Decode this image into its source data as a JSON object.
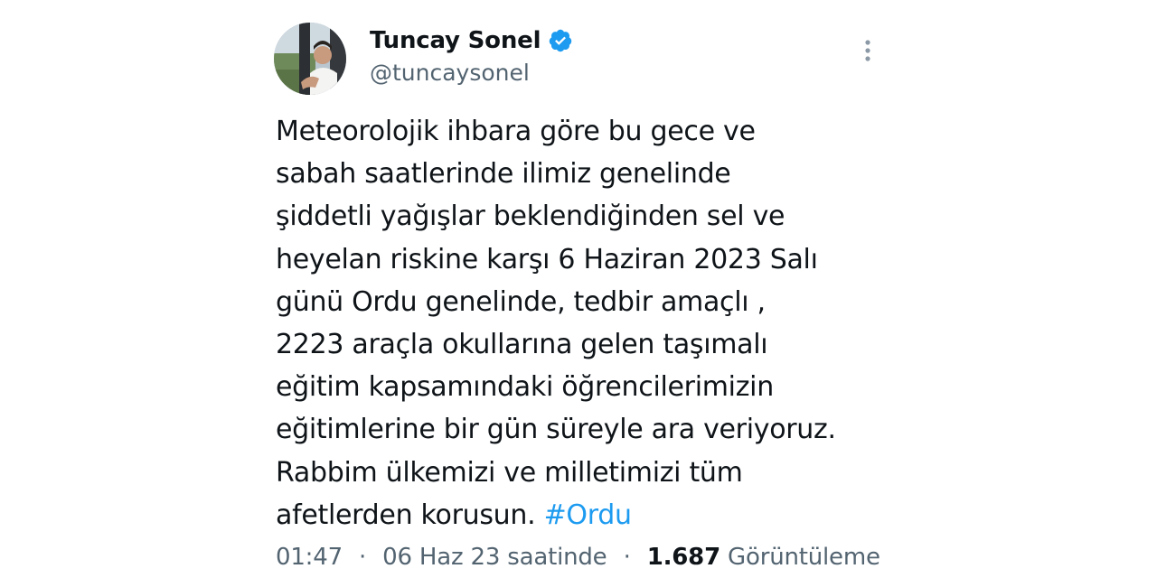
{
  "author": {
    "display_name": "Tuncay Sonel",
    "handle": "@tuncaysonel",
    "verified_icon": "verified-badge-icon",
    "avatar_icon": "profile-photo",
    "more_icon": "more-options-icon"
  },
  "tweet": {
    "lines": [
      "Meteorolojik ihbara göre bu gece ve",
      "sabah saatlerinde ilimiz genelinde",
      "şiddetli yağışlar beklendiğinden sel ve",
      "heyelan riskine karşı 6 Haziran 2023 Salı",
      "günü Ordu genelinde, tedbir amaçlı ,",
      "2223 araçla okullarına gelen taşımalı",
      "eğitim kapsamındaki öğrencilerimizin",
      "eğitimlerine bir gün süreyle ara veriyoruz.",
      "Rabbim ülkemizi ve milletimizi tüm"
    ],
    "last_line_text": "afetlerden korusun. ",
    "hashtag": "#Ordu"
  },
  "meta": {
    "time": "01:47",
    "date": "06 Haz 23 saatinde",
    "separator": "·",
    "views_count": "1.687",
    "views_label": "Görüntüleme"
  },
  "colors": {
    "text": "#0f1419",
    "secondary": "#536471",
    "accent": "#1d9bf0"
  }
}
